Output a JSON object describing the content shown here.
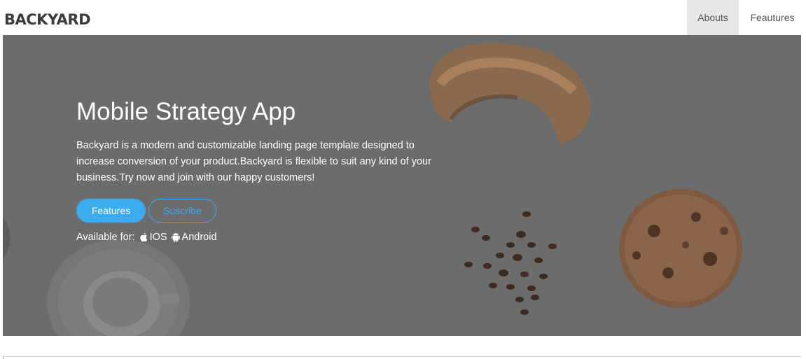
{
  "brand": {
    "logo_text": "BACKYARD",
    "accent_color": "#2f8a6a"
  },
  "nav": {
    "items": [
      {
        "label": "Abouts",
        "active": true
      },
      {
        "label": "Feautures",
        "active": false
      }
    ]
  },
  "hero": {
    "title": "Mobile Strategy App",
    "description": "Backyard is a modern and customizable landing page template designed to increase conversion of your product.Backyard is flexible to suit any kind of your business.Try now and join with our happy customers!",
    "primary_button": "Features",
    "secondary_button": "Suscribe",
    "available_label": "Available for:",
    "platforms": [
      {
        "icon": "apple-icon",
        "label": "IOS"
      },
      {
        "icon": "android-icon",
        "label": "Android"
      }
    ],
    "overlay_color": "#6c6c6c",
    "button_color": "#3cabf0"
  }
}
